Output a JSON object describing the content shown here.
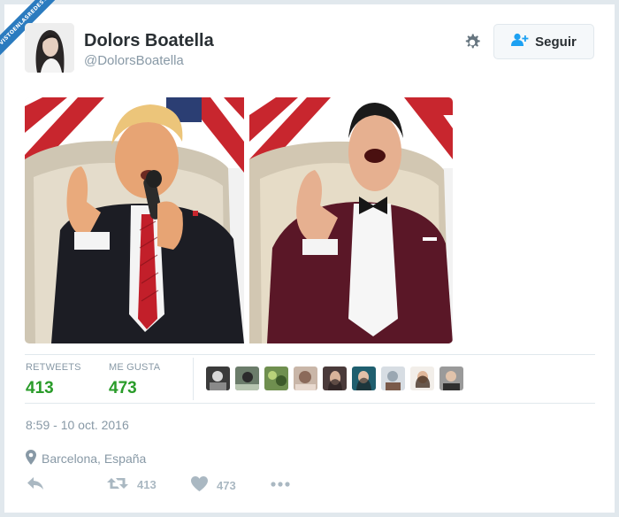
{
  "watermark": {
    "text": "VISTOENLASREDES",
    "suffix": ".com"
  },
  "profile": {
    "name": "Dolors Boatella",
    "handle": "@DolorsBoatella"
  },
  "follow_button": {
    "label": "Seguir",
    "icon": "add-user-icon"
  },
  "settings": {
    "icon": "gear-icon"
  },
  "stats": {
    "retweets_label": "RETWEETS",
    "retweets_value": "413",
    "likes_label": "ME GUSTA",
    "likes_value": "473"
  },
  "likers": [
    "liker-1",
    "liker-2",
    "liker-3",
    "liker-4",
    "liker-5",
    "liker-6",
    "liker-7",
    "liker-8",
    "liker-9"
  ],
  "timestamp": "8:59 - 10 oct. 2016",
  "location": {
    "icon": "location-pin-icon",
    "text": "Barcelona, España"
  },
  "actions": {
    "reply_icon": "reply-icon",
    "retweet_icon": "retweet-icon",
    "retweet_count": "413",
    "like_icon": "heart-icon",
    "like_count": "473",
    "more_icon": "more-icon"
  },
  "colors": {
    "accent_green": "#2a9c2a",
    "muted": "#8899a6",
    "icon_gray": "#aab8c2",
    "border": "#e1e8ed"
  }
}
